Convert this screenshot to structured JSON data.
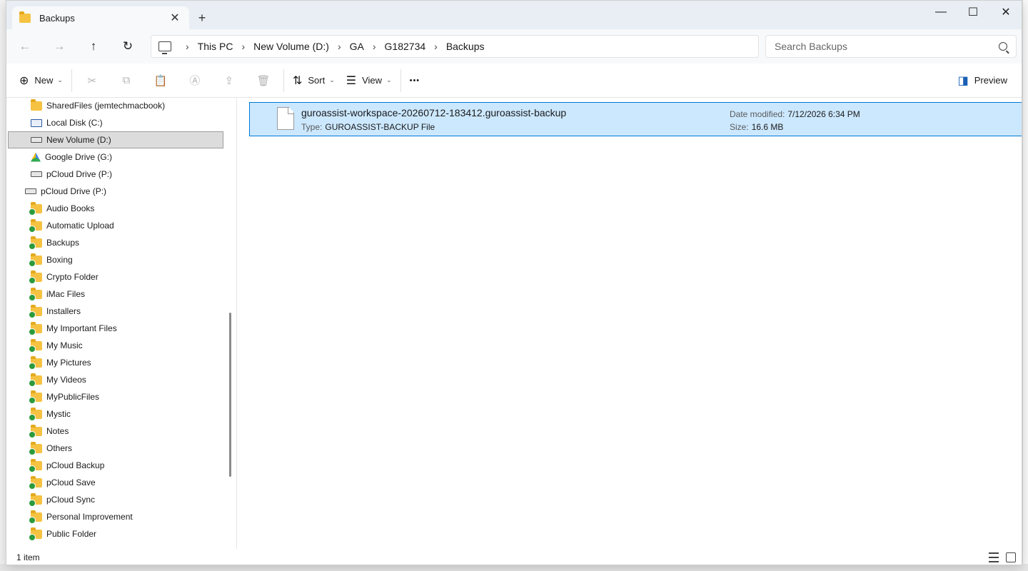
{
  "window": {
    "tab_title": "Backups",
    "close_tab": "✕",
    "new_tab": "+",
    "minimize": "—",
    "maximize": "☐",
    "close": "✕"
  },
  "nav": {
    "back": "←",
    "forward": "→",
    "up": "↑",
    "refresh": "↻"
  },
  "breadcrumb": [
    "This PC",
    "New Volume (D:)",
    "GA",
    "G182734",
    "Backups"
  ],
  "breadcrumb_separator": "›",
  "search": {
    "placeholder": "Search Backups"
  },
  "toolbar": {
    "new_label": "New",
    "sort_label": "Sort",
    "view_label": "View",
    "more_label": "•••",
    "preview_label": "Preview",
    "cut": "✂",
    "copy": "⧉",
    "paste": "📋",
    "rename": "Ⓐ",
    "share": "⇪",
    "delete": "🗑"
  },
  "sidebar": {
    "items": [
      {
        "label": "SharedFiles (jemtechmacbook)",
        "icon": "folder-icon"
      },
      {
        "label": "Local Disk (C:)",
        "icon": "drive-icon"
      },
      {
        "label": "New Volume (D:)",
        "icon": "drive-icon",
        "selected": true
      },
      {
        "label": "Google Drive (G:)",
        "icon": "google-drive-icon"
      },
      {
        "label": "pCloud Drive (P:)",
        "icon": "drive-icon"
      },
      {
        "label": "pCloud Drive (P:)",
        "icon": "drive-icon"
      },
      {
        "label": "Audio Books",
        "icon": "folder-icon"
      },
      {
        "label": "Automatic Upload",
        "icon": "folder-icon"
      },
      {
        "label": "Backups",
        "icon": "folder-icon"
      },
      {
        "label": "Boxing",
        "icon": "folder-icon"
      },
      {
        "label": "Crypto Folder",
        "icon": "folder-icon"
      },
      {
        "label": "iMac Files",
        "icon": "folder-icon"
      },
      {
        "label": "Installers",
        "icon": "folder-icon"
      },
      {
        "label": "My Important Files",
        "icon": "folder-icon"
      },
      {
        "label": "My Music",
        "icon": "folder-icon"
      },
      {
        "label": "My Pictures",
        "icon": "folder-icon"
      },
      {
        "label": "My Videos",
        "icon": "folder-icon"
      },
      {
        "label": "MyPublicFiles",
        "icon": "folder-icon"
      },
      {
        "label": "Mystic",
        "icon": "folder-icon"
      },
      {
        "label": "Notes",
        "icon": "folder-icon"
      },
      {
        "label": "Others",
        "icon": "folder-icon"
      },
      {
        "label": "pCloud Backup",
        "icon": "folder-icon"
      },
      {
        "label": "pCloud Save",
        "icon": "folder-icon"
      },
      {
        "label": "pCloud Sync",
        "icon": "folder-icon"
      },
      {
        "label": "Personal Improvement",
        "icon": "folder-icon"
      },
      {
        "label": "Public Folder",
        "icon": "folder-icon"
      }
    ]
  },
  "file": {
    "name": "guroassist-workspace-20260712-183412.guroassist-backup",
    "type_label": "Type:",
    "type_value": "GUROASSIST-BACKUP File",
    "modified_label": "Date modified:",
    "modified_value": "7/12/2026 6:34 PM",
    "size_label": "Size:",
    "size_value": "16.6 MB"
  },
  "status": {
    "item_count": "1 item"
  },
  "colors": {
    "selection_bg": "#cce8ff",
    "selection_border": "#0078d4",
    "folder": "#f5c242",
    "sync_ok": "#2c9a3c"
  }
}
